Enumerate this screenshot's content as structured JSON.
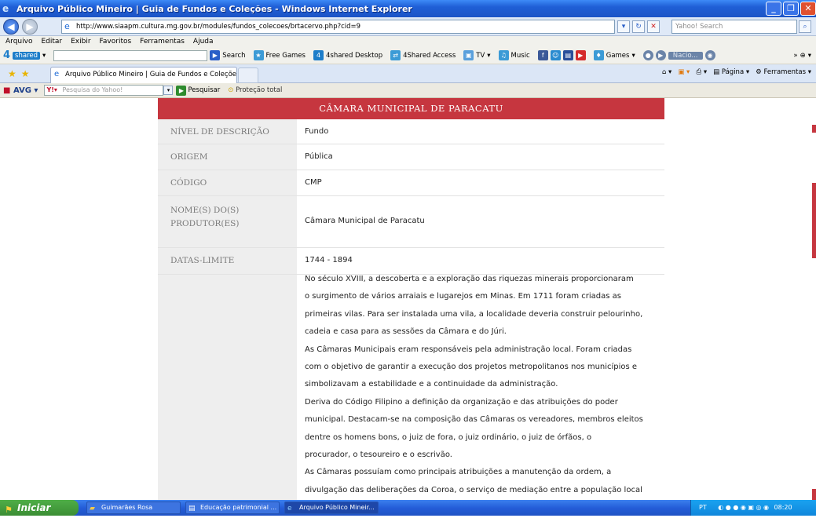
{
  "window": {
    "title": "Arquivo Público Mineiro | Guia de Fundos e Coleções - Windows Internet Explorer"
  },
  "address_bar": {
    "url": "http://www.siaapm.cultura.mg.gov.br/modules/fundos_colecoes/brtacervo.php?cid=9",
    "search_placeholder": "Yahoo! Search"
  },
  "menu": [
    "Arquivo",
    "Editar",
    "Exibir",
    "Favoritos",
    "Ferramentas",
    "Ajuda"
  ],
  "toolbar": {
    "shared": "shared",
    "search": "Search",
    "free_games": "Free Games",
    "desktop": "4shared Desktop",
    "access": "4Shared Access",
    "tv": "TV",
    "music": "Music",
    "games": "Games",
    "radio": "Nacio..."
  },
  "tab": {
    "label": "Arquivo Público Mineiro | Guia de Fundos e Coleções"
  },
  "command_bar": {
    "page": "Página",
    "tools": "Ferramentas"
  },
  "avg_bar": {
    "brand": "AVG",
    "yahoo_placeholder": "Pesquisa do Yahoo!",
    "search_button": "Pesquisar",
    "protection": "Proteção total"
  },
  "record": {
    "header": "CÂMARA MUNICIPAL DE PARACATU",
    "rows": [
      {
        "label": "NÍVEL DE DESCRIÇÃO",
        "value": "Fundo"
      },
      {
        "label": "ORIGEM",
        "value": "Pública"
      },
      {
        "label": "CÓDIGO",
        "value": "CMP"
      },
      {
        "label": "NOME(S) DO(S) PRODUTOR(ES)",
        "value": "Câmara Municipal de Paracatu"
      },
      {
        "label": "DATAS-LIMITE",
        "value": "1744 - 1894"
      }
    ],
    "description_lines": [
      "No século XVIII, a descoberta e a exploração das riquezas minerais proporcionaram",
      "o surgimento de vários arraiais e lugarejos em Minas. Em 1711 foram criadas as",
      "primeiras vilas. Para ser instalada uma vila, a localidade deveria construir pelourinho,",
      "cadeia e casa para as sessões da Câmara e do Júri.",
      "As Câmaras Municipais eram responsáveis pela administração local. Foram criadas",
      "com o objetivo de garantir a execução dos projetos metropolitanos nos municípios e",
      "simbolizavam a estabilidade e a continuidade da administração.",
      "Deriva do Código Filipino a definição da organização e das atribuições do poder",
      "municipal. Destacam-se na composição das Câmaras os vereadores, membros eleitos",
      "dentre os homens bons, o juiz de fora, o juiz ordinário, o juiz de órfãos, o",
      "procurador, o tesoureiro e o escrivão.",
      "As Câmaras possuíam como principais atribuições a manutenção da ordem, a",
      "divulgação das deliberações da Coroa, o serviço de mediação entre a população local"
    ]
  },
  "taskbar": {
    "start": "Iniciar",
    "tasks": [
      "Guimarães Rosa",
      "Educação patrimonial ...",
      "Arquivo Público Mineir..."
    ],
    "lang": "PT",
    "clock": "08:20"
  },
  "colors": {
    "accent": "#c6363f",
    "label_bg": "#eeeeee"
  }
}
